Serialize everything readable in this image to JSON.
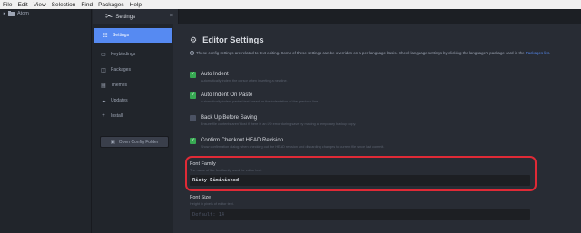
{
  "menubar": {
    "items": [
      "File",
      "Edit",
      "View",
      "Selection",
      "Find",
      "Packages",
      "Help"
    ]
  },
  "tree": {
    "root": "Atom"
  },
  "tab": {
    "title": "Settings",
    "close": "×"
  },
  "panel": {
    "items": [
      {
        "label": "Settings",
        "icon": "settings-sliders-icon"
      },
      {
        "label": "Keybindings",
        "icon": "keyboard-icon"
      },
      {
        "label": "Packages",
        "icon": "package-icon"
      },
      {
        "label": "Themes",
        "icon": "paintcan-icon"
      },
      {
        "label": "Updates",
        "icon": "cloud-download-icon"
      },
      {
        "label": "Install",
        "icon": "plus-icon"
      }
    ],
    "open_config": "Open Config Folder"
  },
  "editor": {
    "title": "Editor Settings",
    "desc_before": "These config settings are related to text editing. Some of these settings can be overriden on a per-language basis. Check language settings by clicking the language's package card in the ",
    "desc_link": "Packages list",
    "desc_after": ".",
    "checks": [
      {
        "label": "Auto Indent",
        "hint": "Automatically indent the cursor when inserting a newline.",
        "checked": true
      },
      {
        "label": "Auto Indent On Paste",
        "hint": "Automatically indent pasted text based on the indentation of the previous line.",
        "checked": true
      },
      {
        "label": "Back Up Before Saving",
        "hint": "Ensure file contents aren't lost if there is an I/O error during save by making a temporary backup copy.",
        "checked": false
      },
      {
        "label": "Confirm Checkout HEAD Revision",
        "hint": "Show confirmation dialog when checking out the HEAD revision and discarding changes to current file since last commit.",
        "checked": true
      }
    ],
    "font_family": {
      "label": "Font Family",
      "hint": "The name of the font family used for editor text.",
      "value": "Ricty Diminished"
    },
    "font_size": {
      "label": "Font Size",
      "hint": "Height in pixels of editor text.",
      "placeholder": "Default: 14"
    }
  },
  "colors": {
    "accent": "#568af2",
    "check": "#37a852",
    "highlight": "#e02a36"
  }
}
